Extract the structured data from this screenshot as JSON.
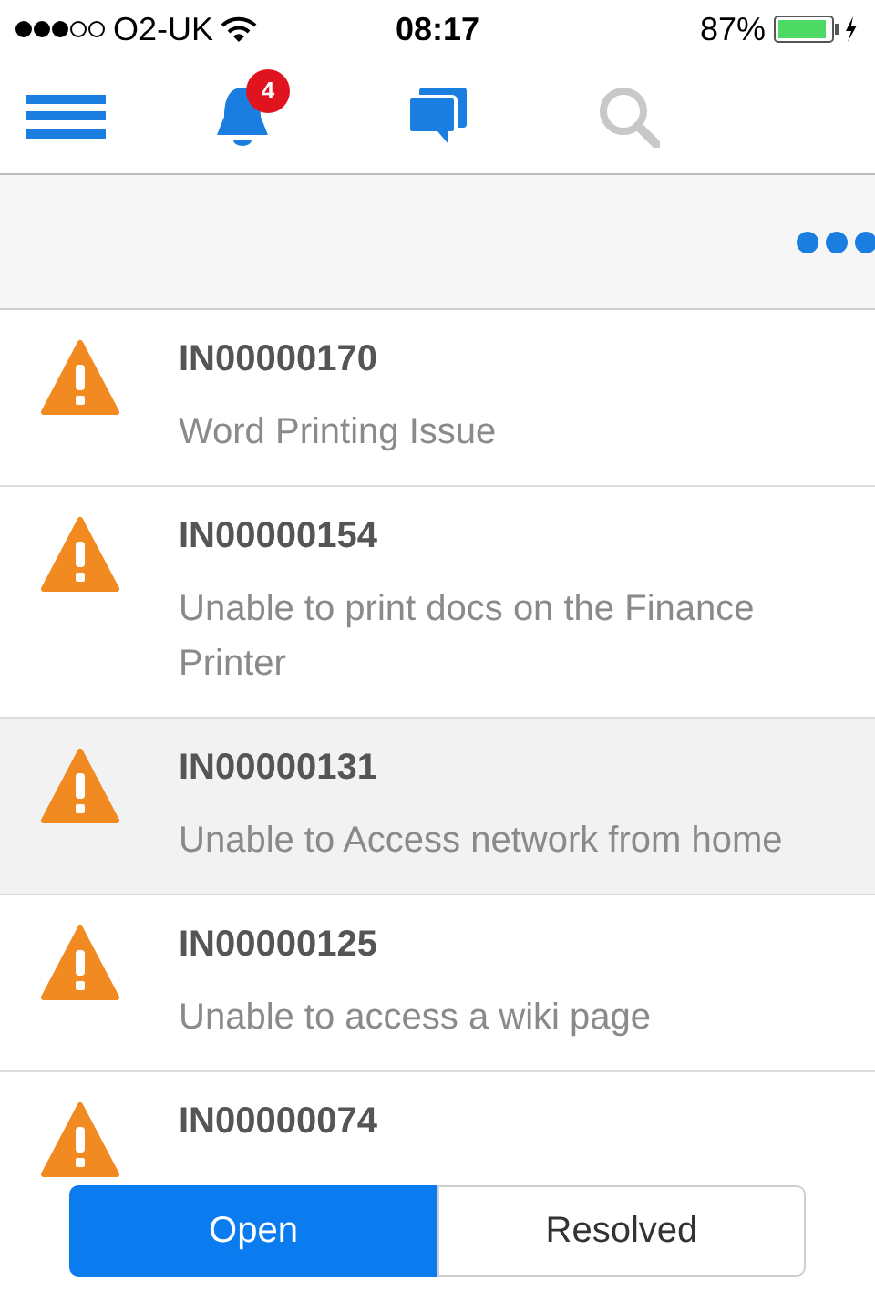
{
  "status_bar": {
    "carrier": "O2-UK",
    "time": "08:17",
    "battery": "87%"
  },
  "nav": {
    "notification_badge": "4"
  },
  "incidents": [
    {
      "id": "IN00000170",
      "title": "Word Printing Issue",
      "selected": false
    },
    {
      "id": "IN00000154",
      "title": "Unable to print docs on the Finance Printer",
      "selected": false
    },
    {
      "id": "IN00000131",
      "title": "Unable to Access network from home",
      "selected": true
    },
    {
      "id": "IN00000125",
      "title": "Unable to access a wiki page",
      "selected": false
    },
    {
      "id": "IN00000074",
      "selected": false
    }
  ],
  "segments": [
    {
      "label": "Open",
      "selected": true
    },
    {
      "label": "Resolved",
      "selected": false
    }
  ]
}
